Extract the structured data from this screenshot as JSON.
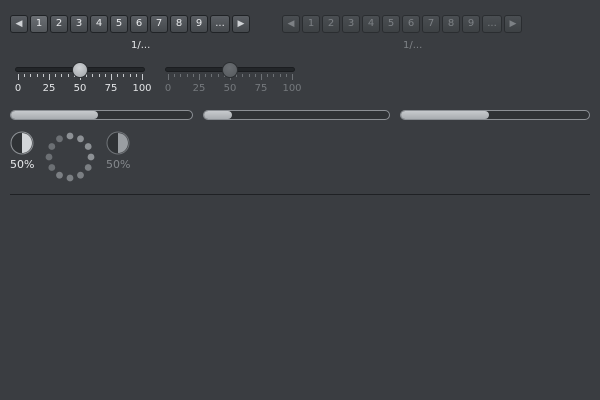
{
  "pager_enabled": {
    "prev_icon": "triangle-left-icon",
    "next_icon": "triangle-right-icon",
    "pages": [
      "1",
      "2",
      "3",
      "4",
      "5",
      "6",
      "7",
      "8",
      "9",
      "..."
    ],
    "active": "1",
    "info": "1/..."
  },
  "pager_disabled": {
    "prev_icon": "triangle-left-icon",
    "next_icon": "triangle-right-icon",
    "pages": [
      "1",
      "2",
      "3",
      "4",
      "5",
      "6",
      "7",
      "8",
      "9",
      "..."
    ],
    "info": "1/..."
  },
  "slider_enabled": {
    "value": 50,
    "min": 0,
    "max": 100,
    "labels": [
      "0",
      "25",
      "50",
      "75",
      "100"
    ]
  },
  "slider_disabled": {
    "value": 50,
    "min": 0,
    "max": 100,
    "labels": [
      "0",
      "25",
      "50",
      "75",
      "100"
    ]
  },
  "progress_bars": [
    {
      "value_fraction": 0.48
    },
    {
      "value_fraction": 0.15
    },
    {
      "value_fraction": 0.47
    }
  ],
  "pie_progress_enabled": {
    "value_fraction": 0.5,
    "label": "50%"
  },
  "pie_progress_disabled": {
    "value_fraction": 0.5,
    "label": "50%"
  },
  "colors": {
    "background": "#3a3d41",
    "accent": "#c7cacd",
    "disabled_text": "#7f8387"
  }
}
